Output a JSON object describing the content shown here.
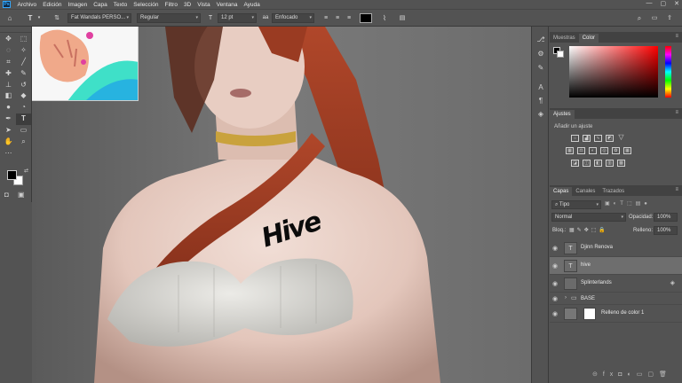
{
  "app": {
    "logo": "Ps"
  },
  "menu": [
    "Archivo",
    "Edición",
    "Imagen",
    "Capa",
    "Texto",
    "Selección",
    "Filtro",
    "3D",
    "Vista",
    "Ventana",
    "Ayuda"
  ],
  "window_controls": {
    "minimize": "—",
    "maximize": "▢",
    "close": "✕"
  },
  "options_bar": {
    "tool_glyph": "T",
    "font_family": "Fat Wandals PERSO...",
    "font_style": "Regular",
    "font_size": "12 pt",
    "antialias": "Enfocado",
    "text_color": "#000000"
  },
  "canvas": {
    "tattoo_text": "Hive"
  },
  "swatches": {
    "foreground": "#000000",
    "background": "#ffffff"
  },
  "panels": {
    "color": {
      "tabs": [
        "Muestras",
        "Color"
      ],
      "active_tab": "Color"
    },
    "adjustments": {
      "tab": "Ajustes",
      "hint": "Añadir un ajuste"
    },
    "layers": {
      "tabs": [
        "Capas",
        "Canales",
        "Trazados"
      ],
      "filter": "Tipo",
      "blend_mode": "Normal",
      "opacity_label": "Opacidad:",
      "opacity_value": "100%",
      "lock_label": "Bloq.:",
      "fill_label": "Relleno:",
      "fill_value": "100%",
      "items": [
        {
          "name": "Djinn Renova",
          "visible": true,
          "kind": "text",
          "selected": false
        },
        {
          "name": "hive",
          "visible": true,
          "kind": "text",
          "selected": true
        },
        {
          "name": "Splinterlands",
          "visible": true,
          "kind": "smart",
          "selected": false
        },
        {
          "name": "BASE",
          "visible": true,
          "kind": "group",
          "selected": false
        },
        {
          "name": "Relleno de color 1",
          "visible": true,
          "kind": "fill",
          "selected": false
        }
      ]
    }
  }
}
